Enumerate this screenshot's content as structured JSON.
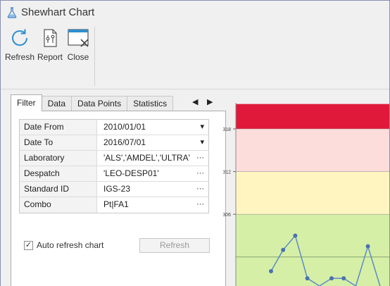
{
  "window": {
    "title": "Shewhart Chart",
    "app_icon": "flask-icon"
  },
  "toolbar": [
    {
      "label": "Refresh",
      "icon": "refresh-icon"
    },
    {
      "label": "Report",
      "icon": "report-icon"
    },
    {
      "label": "Close",
      "icon": "close-window-icon"
    }
  ],
  "tabs": [
    "Filter",
    "Data",
    "Data Points",
    "Statistics"
  ],
  "filter": {
    "rows": [
      {
        "name": "Date From",
        "value": "2010/01/01",
        "control": "▾"
      },
      {
        "name": "Date To",
        "value": "2016/07/01",
        "control": "▾"
      },
      {
        "name": "Laboratory",
        "value": "'ALS','AMDEL','ULTRA'",
        "control": "···"
      },
      {
        "name": "Despatch",
        "value": "'LEO-DESP01'",
        "control": "···"
      },
      {
        "name": "Standard ID",
        "value": "IGS-23",
        "control": "···"
      },
      {
        "name": "Combo",
        "value": "Pt|FA1",
        "control": "···"
      }
    ],
    "auto_refresh_label": "Auto refresh chart",
    "auto_refresh_checked": true,
    "refresh_button_label": "Refresh"
  },
  "chart_data": {
    "type": "line",
    "y_ticks": [
      318,
      312,
      306
    ],
    "bands": [
      {
        "from": 318,
        "to": 321.5,
        "color": "#e0193a"
      },
      {
        "from": 312,
        "to": 318,
        "color": "#fddcdc"
      },
      {
        "from": 306,
        "to": 312,
        "color": "#fff5c0"
      },
      {
        "from": 290,
        "to": 306,
        "color": "#d6efa6"
      }
    ],
    "center_line": 300,
    "series": [
      {
        "values": [
          298,
          301,
          303,
          297,
          290,
          297,
          297,
          290,
          301.5,
          290
        ]
      }
    ],
    "colors": {
      "line": "#5b8bc9",
      "marker": "#4a72b0"
    }
  }
}
